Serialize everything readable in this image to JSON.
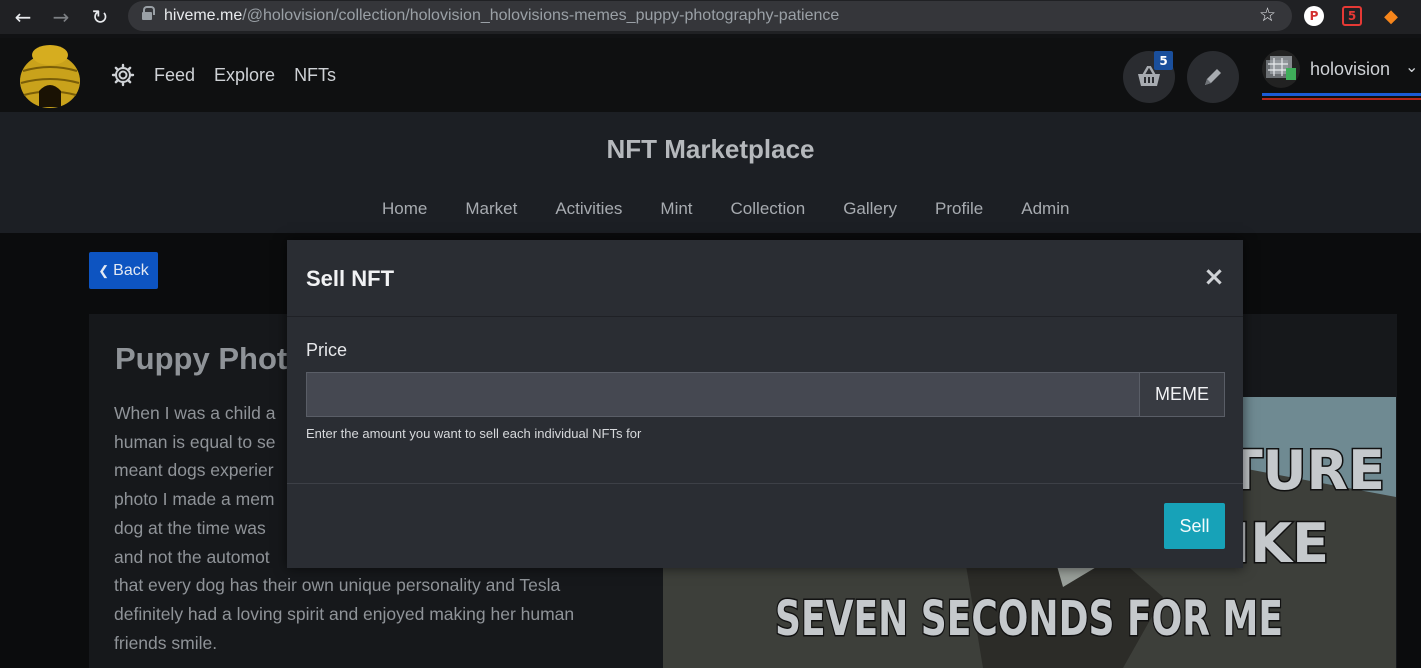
{
  "browser": {
    "url_host": "hiveme.me",
    "url_path": "/@holovision/collection/holovision_holovisions-memes_puppy-photography-patience"
  },
  "header": {
    "nav": [
      "Feed",
      "Explore",
      "NFTs"
    ],
    "cart_count": "5",
    "username": "holovision"
  },
  "marketplace": {
    "title": "NFT Marketplace",
    "tabs": [
      "Home",
      "Market",
      "Activities",
      "Mint",
      "Collection",
      "Gallery",
      "Profile",
      "Admin"
    ]
  },
  "page": {
    "back_label": "Back",
    "title": "Puppy Phot",
    "description_lines": [
      "When I was a child a",
      "human is equal to se",
      "meant dogs experier",
      "photo I made a mem",
      "dog at the time was",
      "and not the automot",
      "that every dog has their own unique personality and Tesla",
      "definitely had a loving spirit and enjoyed making her human",
      "friends smile."
    ],
    "meme_text": [
      "CTURE",
      "LIKE",
      "SEVEN SECONDS FOR ME"
    ]
  },
  "modal": {
    "title": "Sell NFT",
    "close_symbol": "×",
    "price_label": "Price",
    "price_value": "",
    "price_placeholder": "",
    "currency": "MEME",
    "help_text": "Enter the amount you want to sell each individual NFTs for",
    "sell_label": "Sell"
  },
  "colors": {
    "accent_button": "#17a2b8",
    "back_button": "#0d54c1",
    "cart_badge": "#1a4f9c"
  },
  "icons": {
    "back": "chevron-left-icon",
    "close": "close-icon",
    "settings": "gear-icon",
    "cart": "basket-icon",
    "edit": "pencil-icon"
  }
}
